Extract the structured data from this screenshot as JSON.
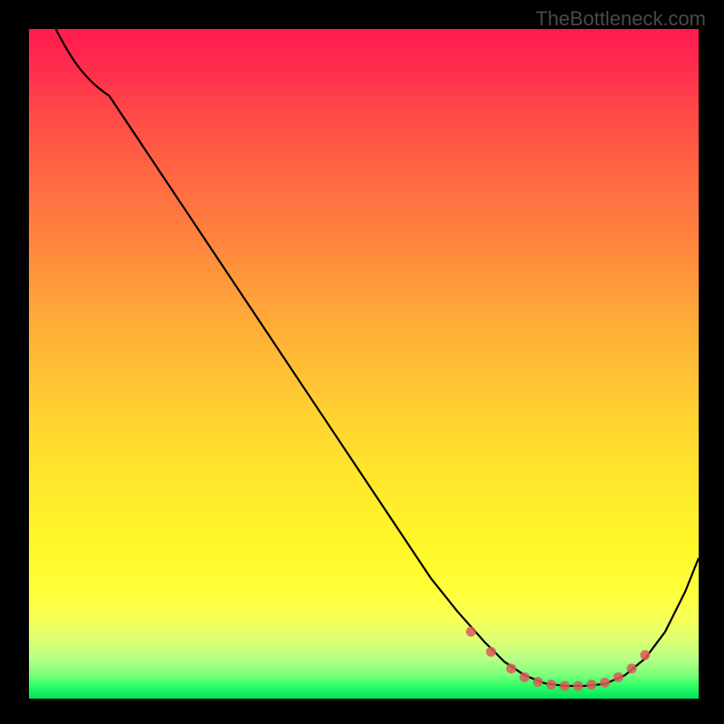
{
  "watermark": "TheBottleneck.com",
  "chart_data": {
    "type": "line",
    "title": "",
    "xlabel": "",
    "ylabel": "",
    "xlim": [
      0,
      100
    ],
    "ylim": [
      0,
      100
    ],
    "grid": false,
    "legend": false,
    "series": [
      {
        "name": "curve",
        "x": [
          4,
          8,
          12,
          16,
          20,
          24,
          28,
          32,
          36,
          40,
          44,
          48,
          52,
          56,
          60,
          64,
          68,
          71,
          74,
          77,
          80,
          83,
          86,
          89,
          92,
          95,
          98,
          100
        ],
        "y": [
          100,
          95,
          90,
          84,
          78,
          72,
          66,
          60,
          54,
          48,
          42,
          36,
          30,
          24,
          18,
          13,
          8.5,
          5.5,
          3.5,
          2.3,
          1.9,
          1.9,
          2.2,
          3.5,
          6,
          10,
          16,
          21
        ]
      }
    ],
    "markers": {
      "name": "bottleneck-zone",
      "x": [
        66,
        69,
        72,
        74,
        76,
        78,
        80,
        82,
        84,
        86,
        88,
        90,
        92
      ],
      "y": [
        10,
        7,
        4.5,
        3.2,
        2.5,
        2.1,
        1.9,
        1.9,
        2.1,
        2.4,
        3.2,
        4.5,
        6.5
      ]
    },
    "gradient": {
      "description": "vertical heat gradient red→yellow→green background",
      "stops": [
        "#ff1a4d",
        "#ffd730",
        "#ffff3a",
        "#30ff66"
      ]
    }
  }
}
